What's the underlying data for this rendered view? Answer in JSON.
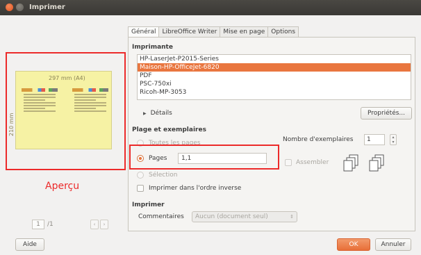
{
  "window": {
    "title": "Imprimer"
  },
  "tabs": [
    "Général",
    "LibreOffice Writer",
    "Mise en page",
    "Options"
  ],
  "printer": {
    "section_label": "Imprimante",
    "items": [
      "HP-LaserJet-P2015-Series",
      "Maison-HP-OfficeJet-6820",
      "PDF",
      "PSC-750xi",
      "Ricoh-MP-3053"
    ],
    "selected_index": 1,
    "details_label": "Détails",
    "properties_button": "Propriétés..."
  },
  "range": {
    "section_label": "Plage et exemplaires",
    "all_pages_label": "Toutes les pages",
    "pages_label": "Pages",
    "pages_value": "1,1",
    "selection_label": "Sélection",
    "reverse_label": "Imprimer dans l'ordre inverse",
    "copies_label": "Nombre d'exemplaires",
    "copies_value": "1",
    "collate_label": "Assembler"
  },
  "print_section": {
    "section_label": "Imprimer",
    "comments_label": "Commentaires",
    "comments_value": "Aucun (document seul)"
  },
  "preview": {
    "width_label": "297 mm (A4)",
    "height_label": "210 mm",
    "caption": "Aperçu",
    "page_current": "1",
    "page_total": "/1"
  },
  "buttons": {
    "help": "Aide",
    "ok": "OK",
    "cancel": "Annuler"
  },
  "colors": {
    "accent": "#e9763f",
    "highlight_box": "#ec2a2a",
    "paper": "#f6f2a4",
    "titlebar": "#3c3b37"
  }
}
